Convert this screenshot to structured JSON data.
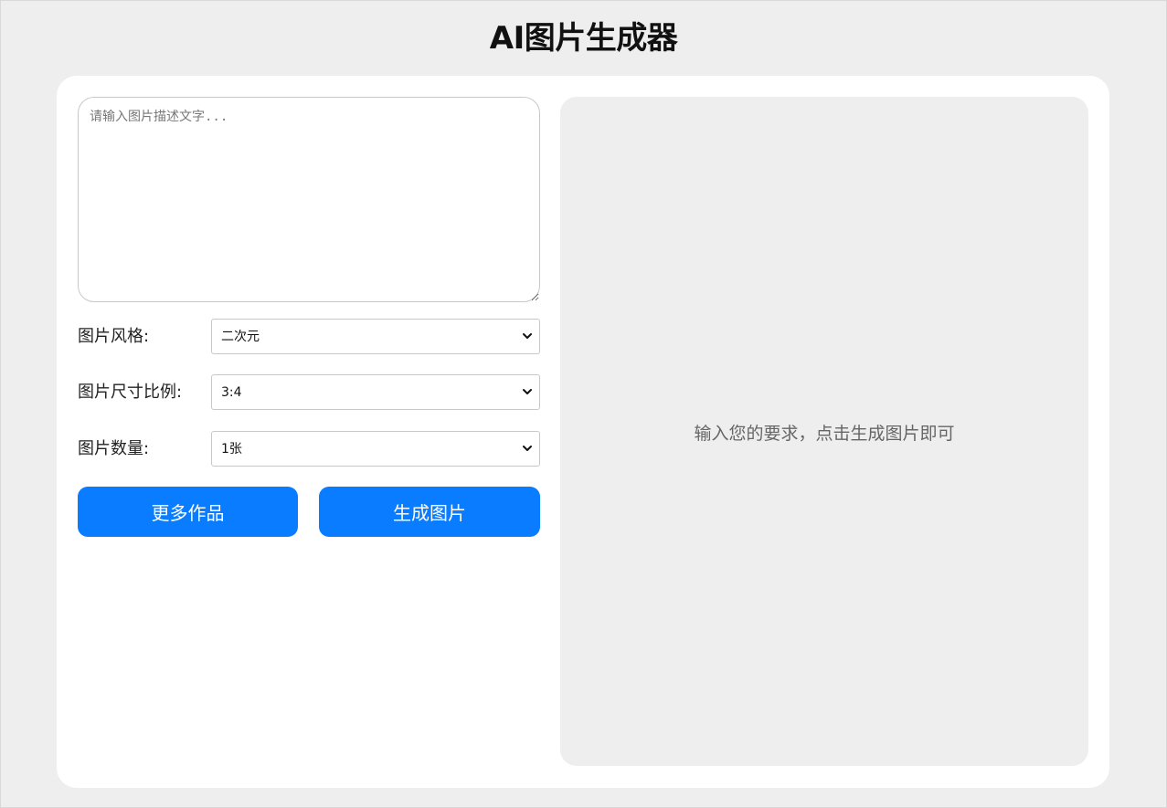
{
  "header": {
    "title": "AI图片生成器"
  },
  "prompt": {
    "placeholder": "请输入图片描述文字...",
    "value": ""
  },
  "form": {
    "style": {
      "label": "图片风格:",
      "selected": "二次元"
    },
    "ratio": {
      "label": "图片尺寸比例:",
      "selected": "3:4"
    },
    "count": {
      "label": "图片数量:",
      "selected": "1张"
    }
  },
  "buttons": {
    "more_label": "更多作品",
    "generate_label": "生成图片"
  },
  "preview": {
    "hint": "输入您的要求，点击生成图片即可"
  },
  "colors": {
    "accent": "#0a7cff",
    "background": "#eeeeee",
    "card": "#ffffff"
  },
  "icons": {
    "select_arrow": "chevron-down-icon"
  }
}
